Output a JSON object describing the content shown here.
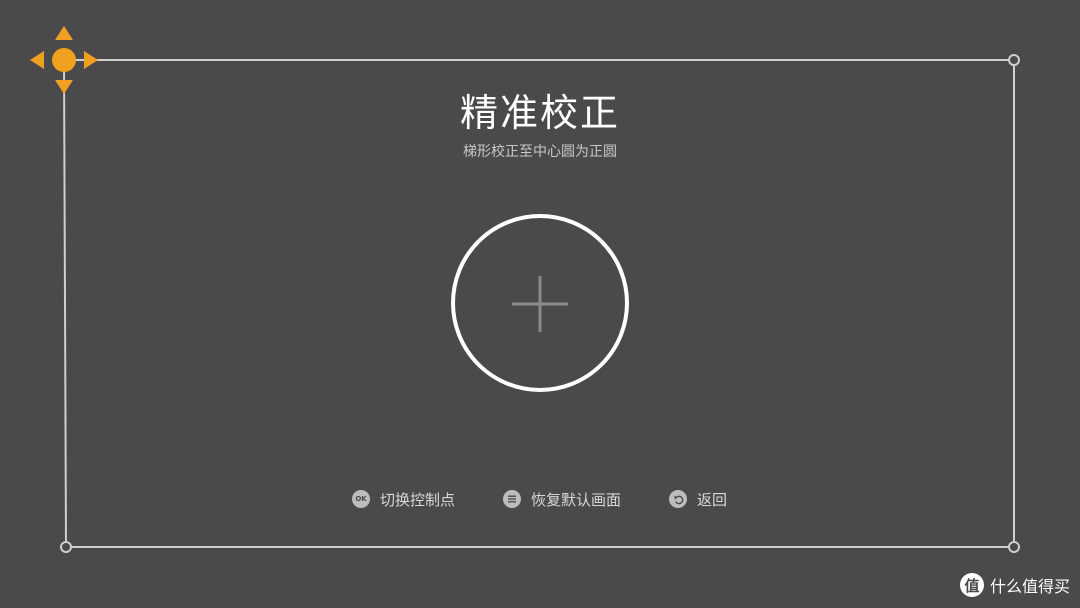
{
  "calibration": {
    "title": "精准校正",
    "subtitle": "梯形校正至中心圆为正圆"
  },
  "hints": [
    {
      "icon": "ok-button-icon",
      "badge": "OK",
      "label": "切换控制点"
    },
    {
      "icon": "menu-button-icon",
      "label": "恢复默认画面"
    },
    {
      "icon": "back-button-icon",
      "label": "返回"
    }
  ],
  "watermark": {
    "logo": "值",
    "text": "什么值得买"
  },
  "colors": {
    "background": "#4a4a4a",
    "frame": "#cfcfcf",
    "active_handle": "#f0a020",
    "circle": "#ffffff",
    "crosshair": "#8a8a8a"
  },
  "icons": {
    "active_handle": "move-arrows-icon",
    "target": "center-circle-crosshair-icon"
  }
}
